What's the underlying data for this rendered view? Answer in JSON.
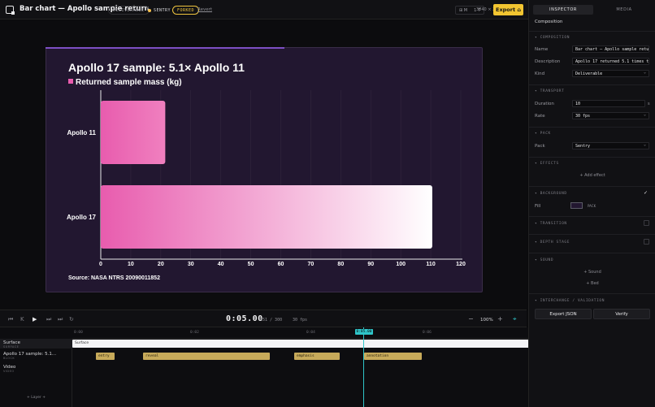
{
  "app": {
    "title": "Bar chart — Apollo sample return",
    "badge_kind": "DELIVERABLE",
    "badge_pack": "SENTRY",
    "badge_forked": "FORKED",
    "revert_label": "Revert",
    "view_toggle_a": "⊞ M",
    "view_toggle_b": "1 T",
    "resolution": "3840 × 2160",
    "export_label": "Export ⌂"
  },
  "chart_data": {
    "type": "bar",
    "orientation": "horizontal",
    "title": "Apollo 17 sample: 5.1× Apollo 11",
    "legend": "Returned sample mass (kg)",
    "categories": [
      "Apollo 11",
      "Apollo 17"
    ],
    "values": [
      21.5,
      110.5
    ],
    "xlim": [
      0,
      120
    ],
    "xticks": [
      "0",
      "10",
      "20",
      "30",
      "40",
      "50",
      "60",
      "70",
      "80",
      "90",
      "100",
      "110",
      "120"
    ],
    "source": "Source: NASA NTRS 20090011852",
    "bar_color": "#e85cae",
    "background": "#221730"
  },
  "transport": {
    "timecode": "0:05.00",
    "frames": "151 / 300",
    "fps": "30 fps",
    "zoom": "100%"
  },
  "timeline": {
    "ticks": [
      "0:00",
      "0:02",
      "0:04",
      "0:06",
      "0:08"
    ],
    "playhead_label": "0:05.00",
    "tracks": [
      {
        "name": "Surface",
        "sub": "SURFACE"
      },
      {
        "name": "Apollo 17 sample: 5.1...",
        "sub": "BLOCK"
      },
      {
        "name": "Video",
        "sub": "VIDEO"
      }
    ],
    "add_layer": "+ Layer +",
    "surface_clip": "Surface",
    "clips": [
      "entry",
      "reveal",
      "emphasis",
      "annotation",
      "exit"
    ]
  },
  "panel": {
    "tab_inspector": "INSPECTOR",
    "tab_media": "MEDIA",
    "heading": "Composition",
    "sec_composition": "▾ COMPOSITION",
    "name_label": "Name",
    "name_value": "Bar chart — Apollo sample retu",
    "desc_label": "Description",
    "desc_value": "Apollo 17 returned 5.1 times th",
    "kind_label": "Kind",
    "kind_value": "Deliverable",
    "sec_transport": "▾ TRANSPORT",
    "duration_label": "Duration",
    "duration_value": "10",
    "duration_unit": "s",
    "rate_label": "Rate",
    "rate_value": "30 fps",
    "sec_pack": "▾ PACK",
    "pack_label": "Pack",
    "pack_value": "Sentry",
    "sec_effects": "▾ EFFECTS",
    "add_effect": "+ Add effect",
    "sec_background": "▾ BACKGROUND",
    "fill_label": "Fill",
    "fill_value": "PACK",
    "sec_transition": "▾ TRANSITION",
    "sec_depth": "▾ DEPTH STAGE",
    "sec_sound": "▾ SOUND",
    "add_sound": "+ Sound",
    "add_bed": "+ Bed",
    "sec_interchange": "▾ INTERCHANGE / VALIDATION",
    "export_json": "Export JSON",
    "verify": "Verify"
  }
}
